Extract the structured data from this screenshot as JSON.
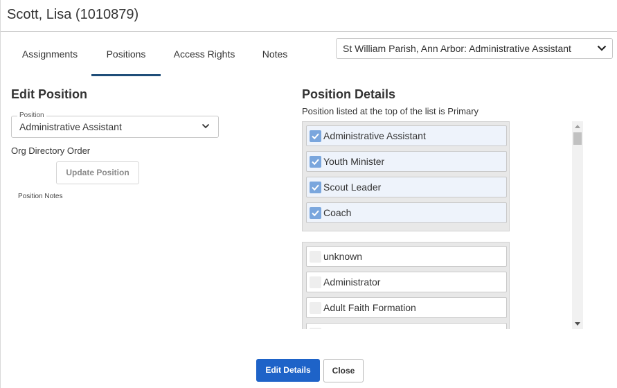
{
  "header": {
    "title": "Scott, Lisa (1010879)"
  },
  "tabs": [
    {
      "label": "Assignments"
    },
    {
      "label": "Positions"
    },
    {
      "label": "Access Rights"
    },
    {
      "label": "Notes"
    }
  ],
  "active_tab": "Positions",
  "context_select": {
    "value": "St William Parish, Ann Arbor: Administrative Assistant"
  },
  "edit_position": {
    "title": "Edit Position",
    "position_field": {
      "label": "Position",
      "value": "Administrative Assistant"
    },
    "org_directory_label": "Org Directory Order",
    "update_button": "Update Position",
    "notes_label": "Position Notes"
  },
  "position_details": {
    "title": "Position Details",
    "subtitle": "Position listed at the top of the list is Primary",
    "selected": [
      {
        "label": "Administrative Assistant",
        "checked": true
      },
      {
        "label": "Youth Minister",
        "checked": true
      },
      {
        "label": "Scout Leader",
        "checked": true
      },
      {
        "label": "Coach",
        "checked": true
      }
    ],
    "available": [
      {
        "label": "unknown",
        "checked": false
      },
      {
        "label": "Administrator",
        "checked": false
      },
      {
        "label": "Adult Faith Formation",
        "checked": false
      }
    ]
  },
  "footer": {
    "edit_button": "Edit Details",
    "close_button": "Close"
  },
  "colors": {
    "primary": "#1e63c8",
    "tab_underline": "#1f4e79",
    "checkbox": "#7aa6dd"
  }
}
